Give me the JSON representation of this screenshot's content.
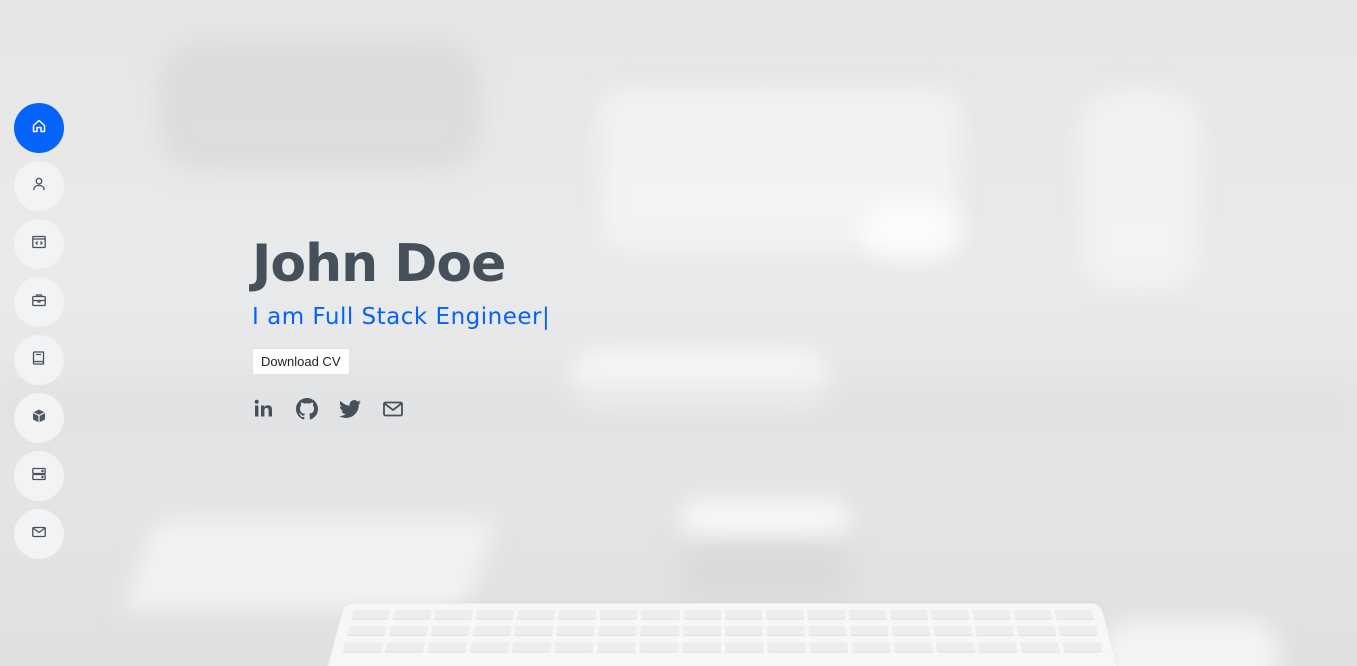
{
  "nav": {
    "items": [
      {
        "icon": "home-icon",
        "active": true
      },
      {
        "icon": "person-icon",
        "active": false
      },
      {
        "icon": "code-window-icon",
        "active": false
      },
      {
        "icon": "briefcase-icon",
        "active": false
      },
      {
        "icon": "book-icon",
        "active": false
      },
      {
        "icon": "box-icon",
        "active": false
      },
      {
        "icon": "server-icon",
        "active": false
      },
      {
        "icon": "envelope-icon",
        "active": false
      }
    ]
  },
  "hero": {
    "name": "John Doe",
    "tagline": "I am Full Stack Engineer",
    "cursor": "|",
    "download_label": "Download CV"
  },
  "social": [
    {
      "icon": "linkedin-icon"
    },
    {
      "icon": "github-icon"
    },
    {
      "icon": "twitter-icon"
    },
    {
      "icon": "envelope-icon"
    }
  ],
  "colors": {
    "accent": "#0563fb",
    "text": "#45505b",
    "nav_bg": "#f2f3f5"
  }
}
